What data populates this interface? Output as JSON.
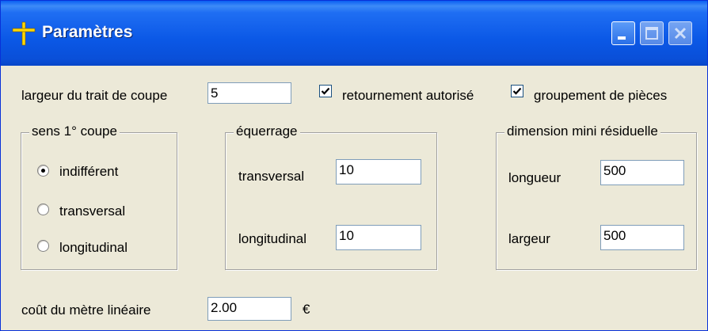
{
  "window": {
    "title": "Paramètres",
    "icon": "saw-cross-icon"
  },
  "top": {
    "kerf_label": "largeur du trait de coupe",
    "kerf_value": "5",
    "rotation_label": "retournement autorisé",
    "rotation_checked": true,
    "grouping_label": "groupement de pièces",
    "grouping_checked": true
  },
  "first_cut": {
    "legend": "sens 1° coupe",
    "options": [
      "indifférent",
      "transversal",
      "longitudinal"
    ],
    "selected": "indifférent"
  },
  "squaring": {
    "legend": "équerrage",
    "transversal_label": "transversal",
    "transversal_value": "10",
    "longitudinal_label": "longitudinal",
    "longitudinal_value": "10"
  },
  "residual": {
    "legend": "dimension mini résiduelle",
    "length_label": "longueur",
    "length_value": "500",
    "width_label": "largeur",
    "width_value": "500"
  },
  "cost": {
    "label": "coût du mètre linéaire",
    "value": "2.00",
    "currency": "€"
  }
}
